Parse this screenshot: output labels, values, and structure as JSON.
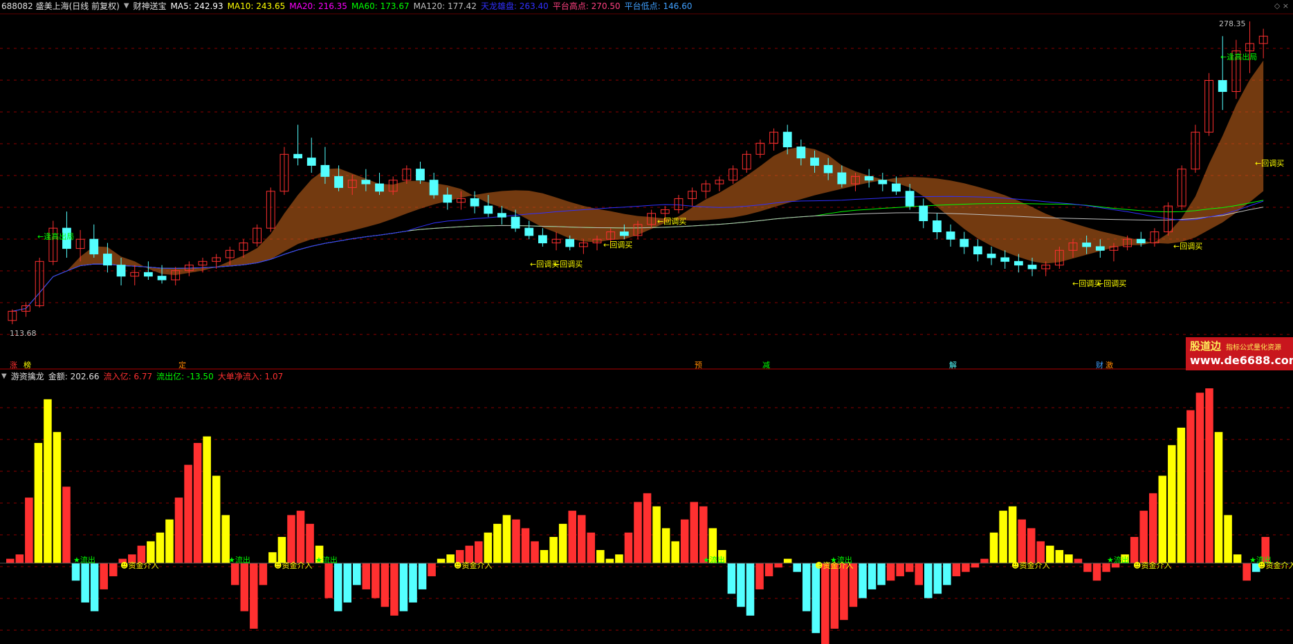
{
  "header_top": {
    "stock": "688082 盛美上海(日线 前复权)",
    "indicator": "财神送宝",
    "ma5": "MA5: 242.93",
    "ma10": "MA10: 243.65",
    "ma20": "MA20: 216.35",
    "ma60": "MA60: 173.67",
    "ma120": "MA120: 177.42",
    "tianlong": "天龙雄盘: 263.40",
    "plat_high": "平台高点: 270.50",
    "plat_low": "平台低点: 146.60"
  },
  "header_bottom": {
    "indicator": "游资擒龙",
    "amount": "金额: 202.66",
    "inflow": "流入亿: 6.77",
    "outflow": "流出亿: -13.50",
    "bignet": "大单净流入: 1.07"
  },
  "price_labels": {
    "high": "278.35",
    "low": "113.68"
  },
  "annotations": {
    "escape_top": "逢高出局",
    "pullback_buy": "回调买",
    "arrow_left": "←",
    "main_force_out": "流出",
    "fund_in": "资金介入"
  },
  "markers": [
    "涨",
    "榜",
    "定",
    "预",
    "减",
    "解",
    "财",
    "激"
  ],
  "logo": {
    "name": "股道边",
    "tagline": "指标公式量化资源",
    "url": "www.de6688.com"
  },
  "colors": {
    "up": "#ff3030",
    "down": "#54ffff",
    "ma5": "#ffffff",
    "ma10": "#ffff00",
    "ma20": "#ff00ff",
    "ma60": "#00ff00",
    "ma120": "#c0c0c0",
    "tianlong": "#3030ff",
    "grid": "#8b0000"
  },
  "chart_data": {
    "type": "candlestick",
    "title": "财神送宝",
    "ylim": [
      113.68,
      278.35
    ],
    "candles": [
      [
        116,
        122,
        114,
        121
      ],
      [
        121,
        126,
        118,
        124
      ],
      [
        124,
        150,
        123,
        148
      ],
      [
        148,
        170,
        146,
        166
      ],
      [
        166,
        175,
        150,
        155
      ],
      [
        155,
        165,
        148,
        160
      ],
      [
        160,
        168,
        150,
        152
      ],
      [
        152,
        158,
        142,
        146
      ],
      [
        146,
        150,
        135,
        140
      ],
      [
        140,
        146,
        135,
        142
      ],
      [
        142,
        148,
        138,
        140
      ],
      [
        140,
        146,
        136,
        138
      ],
      [
        138,
        145,
        135,
        143
      ],
      [
        143,
        148,
        140,
        146
      ],
      [
        146,
        150,
        142,
        148
      ],
      [
        148,
        152,
        144,
        150
      ],
      [
        150,
        156,
        146,
        154
      ],
      [
        154,
        160,
        150,
        158
      ],
      [
        158,
        168,
        156,
        166
      ],
      [
        166,
        188,
        164,
        186
      ],
      [
        186,
        210,
        184,
        206
      ],
      [
        206,
        222,
        200,
        204
      ],
      [
        204,
        215,
        196,
        200
      ],
      [
        200,
        210,
        190,
        194
      ],
      [
        194,
        200,
        186,
        188
      ],
      [
        188,
        195,
        184,
        192
      ],
      [
        192,
        198,
        186,
        190
      ],
      [
        190,
        196,
        184,
        186
      ],
      [
        186,
        194,
        184,
        192
      ],
      [
        192,
        200,
        190,
        198
      ],
      [
        198,
        202,
        190,
        192
      ],
      [
        192,
        196,
        182,
        184
      ],
      [
        184,
        188,
        176,
        180
      ],
      [
        180,
        186,
        176,
        182
      ],
      [
        182,
        186,
        174,
        178
      ],
      [
        178,
        184,
        172,
        174
      ],
      [
        174,
        178,
        168,
        172
      ],
      [
        172,
        176,
        164,
        166
      ],
      [
        166,
        170,
        160,
        162
      ],
      [
        162,
        166,
        156,
        158
      ],
      [
        158,
        164,
        154,
        160
      ],
      [
        160,
        162,
        154,
        156
      ],
      [
        156,
        160,
        152,
        158
      ],
      [
        158,
        162,
        154,
        160
      ],
      [
        160,
        166,
        156,
        164
      ],
      [
        164,
        168,
        160,
        162
      ],
      [
        162,
        170,
        160,
        168
      ],
      [
        168,
        176,
        166,
        174
      ],
      [
        174,
        178,
        170,
        176
      ],
      [
        176,
        184,
        174,
        182
      ],
      [
        182,
        188,
        178,
        186
      ],
      [
        186,
        192,
        182,
        190
      ],
      [
        190,
        194,
        186,
        192
      ],
      [
        192,
        200,
        190,
        198
      ],
      [
        198,
        208,
        196,
        206
      ],
      [
        206,
        214,
        204,
        212
      ],
      [
        212,
        220,
        208,
        218
      ],
      [
        218,
        222,
        206,
        210
      ],
      [
        210,
        214,
        200,
        204
      ],
      [
        204,
        208,
        196,
        200
      ],
      [
        200,
        204,
        192,
        196
      ],
      [
        196,
        200,
        188,
        190
      ],
      [
        190,
        196,
        186,
        194
      ],
      [
        194,
        198,
        188,
        192
      ],
      [
        192,
        196,
        186,
        190
      ],
      [
        190,
        194,
        184,
        186
      ],
      [
        186,
        190,
        176,
        178
      ],
      [
        178,
        182,
        166,
        170
      ],
      [
        170,
        174,
        160,
        164
      ],
      [
        164,
        168,
        156,
        160
      ],
      [
        160,
        164,
        152,
        156
      ],
      [
        156,
        160,
        148,
        152
      ],
      [
        152,
        156,
        146,
        150
      ],
      [
        150,
        154,
        144,
        148
      ],
      [
        148,
        152,
        142,
        146
      ],
      [
        146,
        150,
        140,
        144
      ],
      [
        144,
        148,
        140,
        146
      ],
      [
        146,
        156,
        144,
        154
      ],
      [
        154,
        160,
        150,
        158
      ],
      [
        158,
        162,
        152,
        156
      ],
      [
        156,
        160,
        150,
        154
      ],
      [
        154,
        158,
        148,
        156
      ],
      [
        156,
        162,
        154,
        160
      ],
      [
        160,
        164,
        156,
        158
      ],
      [
        158,
        166,
        156,
        164
      ],
      [
        164,
        180,
        162,
        178
      ],
      [
        178,
        200,
        176,
        198
      ],
      [
        198,
        222,
        196,
        218
      ],
      [
        218,
        250,
        216,
        246
      ],
      [
        246,
        270,
        230,
        240
      ],
      [
        240,
        268,
        236,
        262
      ],
      [
        262,
        278,
        250,
        266
      ],
      [
        266,
        274,
        258,
        270
      ]
    ],
    "flow_values": [
      2,
      4,
      30,
      55,
      75,
      60,
      35,
      -8,
      -18,
      -22,
      -12,
      -6,
      2,
      4,
      8,
      10,
      14,
      20,
      30,
      45,
      55,
      58,
      40,
      22,
      -10,
      -22,
      -30,
      -10,
      5,
      12,
      22,
      24,
      18,
      8,
      -16,
      -22,
      -18,
      -10,
      -12,
      -16,
      -20,
      -24,
      -22,
      -18,
      -12,
      -6,
      2,
      4,
      6,
      8,
      10,
      14,
      18,
      22,
      20,
      16,
      10,
      6,
      12,
      18,
      24,
      22,
      14,
      6,
      2,
      4,
      14,
      28,
      32,
      26,
      16,
      10,
      20,
      28,
      26,
      16,
      6,
      -14,
      -20,
      -24,
      -12,
      -6,
      -2,
      2,
      -4,
      -22,
      -32,
      -38,
      -30,
      -26,
      -20,
      -16,
      -12,
      -10,
      -8,
      -6,
      -4,
      -10,
      -16,
      -14,
      -10,
      -6,
      -4,
      -2,
      2,
      14,
      24,
      26,
      20,
      16,
      10,
      8,
      6,
      4,
      2,
      -4,
      -8,
      -4,
      -2,
      4,
      12,
      24,
      32,
      40,
      54,
      62,
      70,
      78,
      80,
      60,
      22,
      4,
      -8,
      -4,
      12
    ]
  }
}
